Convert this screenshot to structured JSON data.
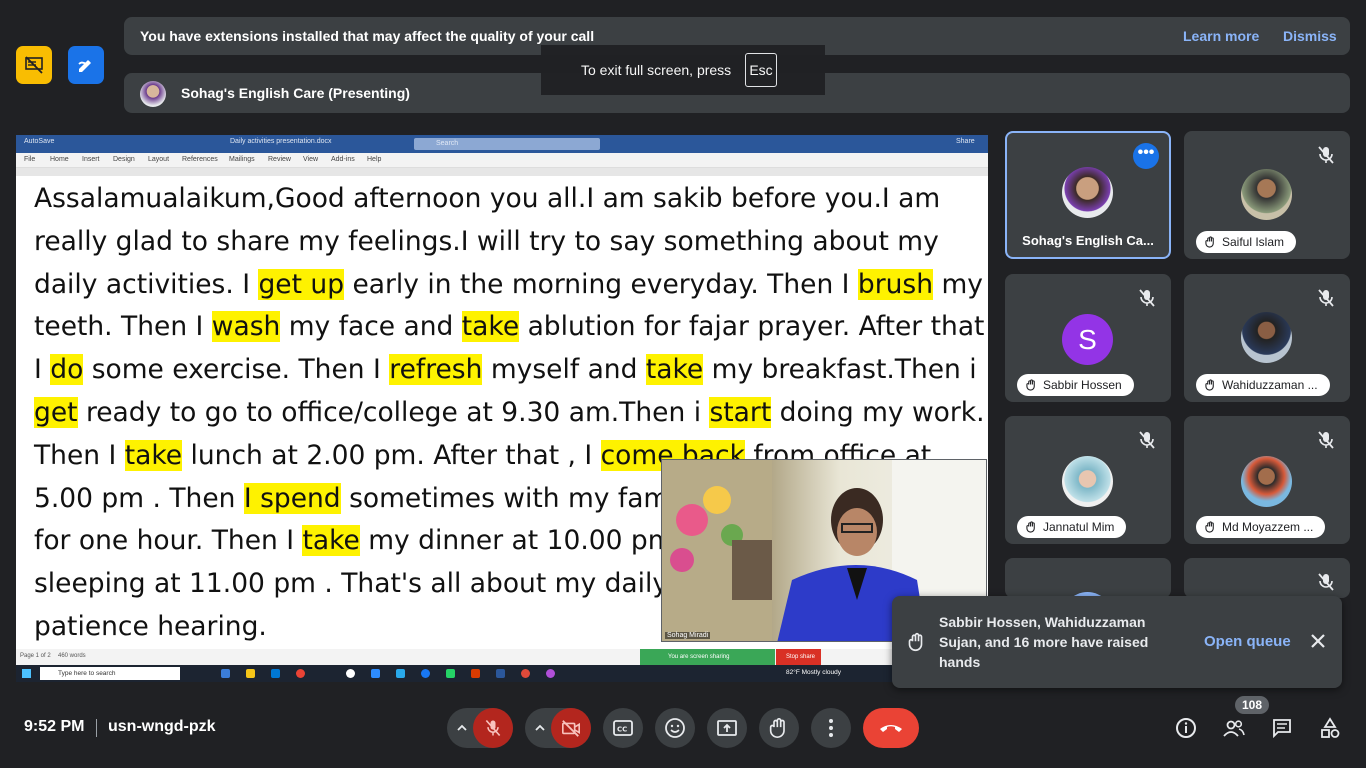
{
  "colors": {
    "accent": "#8ab4f8",
    "danger": "#ea4335",
    "surface": "#3c4043",
    "background": "#202124",
    "highlight": "#fef200"
  },
  "extension_banner": {
    "message": "You have extensions installed that may affect the quality of your call",
    "learn_more": "Learn more",
    "dismiss": "Dismiss"
  },
  "presenter_banner": {
    "title": "Sohag's English Care (Presenting)"
  },
  "fullscreen_tip": {
    "text": "To exit full screen, press",
    "key": "Esc"
  },
  "presentation": {
    "word": {
      "autosave": "AutoSave",
      "doc_title": "Daily activities presentation.docx",
      "search": "Search",
      "share": "Share",
      "menu": [
        "File",
        "Home",
        "Insert",
        "Design",
        "Layout",
        "References",
        "Mailings",
        "Review",
        "View",
        "Add-ins",
        "Help"
      ],
      "status_page": "Page 1 of 2",
      "status_words": "460 words"
    },
    "paragraph_lines": [
      "Assalamualaikum,Good afternoon you all.I am sakib before you.I am",
      "really glad to share my feelings.I will try to say something about my",
      "daily activities. I get up early in the morning everyday. Then I brush my",
      "teeth. Then I wash my face and take ablution for fajar prayer. After that",
      "I do some exercise. Then I refresh myself and take my breakfast.Then i",
      "get ready to go to office/college at 9.30 am.Then i start doing my work.",
      "Then I take lunch at 2.00 pm. After that , I come back from office at",
      "5.00 pm . Then I spend sometimes with my fam",
      "for one hour. Then I take my dinner at 10.00 pm",
      "sleeping at 11.00 pm . That's all about my daily",
      "patience hearing."
    ],
    "self_video_name": "Sohag Miradi",
    "sharing_bar": {
      "text": "You are screen sharing",
      "stop": "Stop share"
    },
    "taskbar": {
      "search": "Type here to search",
      "weather": "82°F  Mostly cloudy"
    }
  },
  "participants": [
    {
      "name": "Sohag's English Ca...",
      "avatar": "photo-avatar",
      "active": true
    },
    {
      "name": "Saiful Islam",
      "avatar": "photo-avatar",
      "hand_raised": true,
      "muted": true
    },
    {
      "name": "Sabbir Hossen",
      "avatar_letter": "S",
      "hand_raised": true,
      "muted": true
    },
    {
      "name": "Wahiduzzaman ...",
      "avatar": "photo-avatar",
      "hand_raised": true,
      "muted": true
    },
    {
      "name": "Jannatul Mim",
      "avatar": "photo-avatar",
      "hand_raised": true,
      "muted": true
    },
    {
      "name": "Md Moyazzem ...",
      "avatar": "photo-avatar",
      "hand_raised": true,
      "muted": true
    }
  ],
  "hand_toast": {
    "message": "Sabbir Hossen, Wahiduzzaman Sujan, and 16 more have raised hands",
    "open_queue": "Open queue"
  },
  "bottom_bar": {
    "time": "9:52 PM",
    "meeting_code": "usn-wngd-pzk",
    "people_count": "108"
  }
}
